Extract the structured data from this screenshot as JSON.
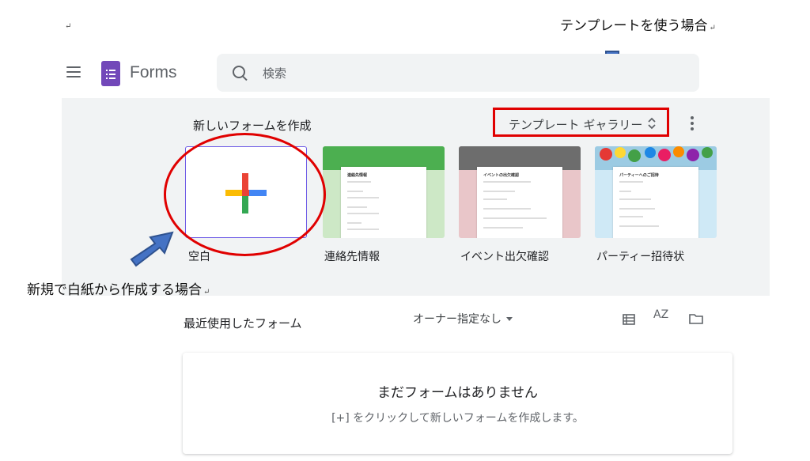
{
  "annotations": {
    "top_mark": "↵",
    "template_case": "テンプレートを使う場合",
    "blank_case": "新規で白紙から作成する場合",
    "return_mark": "↵"
  },
  "header": {
    "app_name": "Forms",
    "search_placeholder": "検索"
  },
  "new_form": {
    "title": "新しいフォームを作成",
    "gallery_label": "テンプレート ギャラリー",
    "templates": [
      {
        "label": "空白",
        "icon": "plus-icon"
      },
      {
        "label": "連絡先情報",
        "thumb_title": "連絡先情報"
      },
      {
        "label": "イベント出欠確認",
        "thumb_title": "イベントの出欠確認"
      },
      {
        "label": "パーティー招待状",
        "thumb_title": "パーティーへのご招待"
      }
    ]
  },
  "recent": {
    "title": "最近使用したフォーム",
    "owner_filter": "オーナー指定なし",
    "sort_label": "AZ",
    "empty_title": "まだフォームはありません",
    "empty_subtitle": "[+] をクリックして新しいフォームを作成します。"
  },
  "colors": {
    "brand_purple": "#7248b9",
    "annotation_red": "#e00000",
    "arrow_blue": "#4472c4"
  }
}
